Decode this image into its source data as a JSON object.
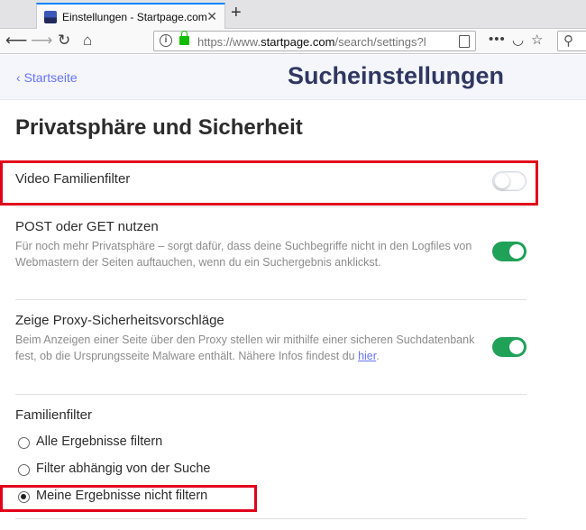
{
  "browser": {
    "tab_title": "Einstellungen - Startpage.com",
    "tab_close": "✕",
    "new_tab": "+",
    "url_scheme": "https://www.",
    "url_host": "startpage.com",
    "url_path": "/search/settings?l"
  },
  "header": {
    "back_label": "Startseite",
    "title": "Sucheinstellungen"
  },
  "section": {
    "title": "Privatsphäre und Sicherheit"
  },
  "settings": [
    {
      "title": "Video Familienfilter",
      "enabled": false
    },
    {
      "title": "POST oder GET nutzen",
      "description": "Für noch mehr Privatsphäre – sorgt dafür, dass deine Suchbegriffe nicht in den Logfiles von Webmastern der Seiten auftauchen, wenn du ein Suchergebnis anklickst.",
      "enabled": true
    },
    {
      "title": "Zeige Proxy-Sicherheitsvorschläge",
      "description": "Beim Anzeigen einer Seite über den Proxy stellen wir mithilfe einer sicheren Suchdatenbank fest, ob die Ursprungsseite Malware enthält. Nähere Infos findest du",
      "link": "hier",
      "link_suffix": ".",
      "enabled": true
    }
  ],
  "family_filter": {
    "title": "Familienfilter",
    "options": [
      {
        "label": "Alle Ergebnisse filtern",
        "selected": false
      },
      {
        "label": "Filter abhängig von der Suche",
        "selected": false
      },
      {
        "label": "Meine Ergebnisse nicht filtern",
        "selected": true
      }
    ]
  },
  "colors": {
    "accent": "#6573ff",
    "toggle_on": "#1fa158",
    "highlight": "#e2001a"
  }
}
